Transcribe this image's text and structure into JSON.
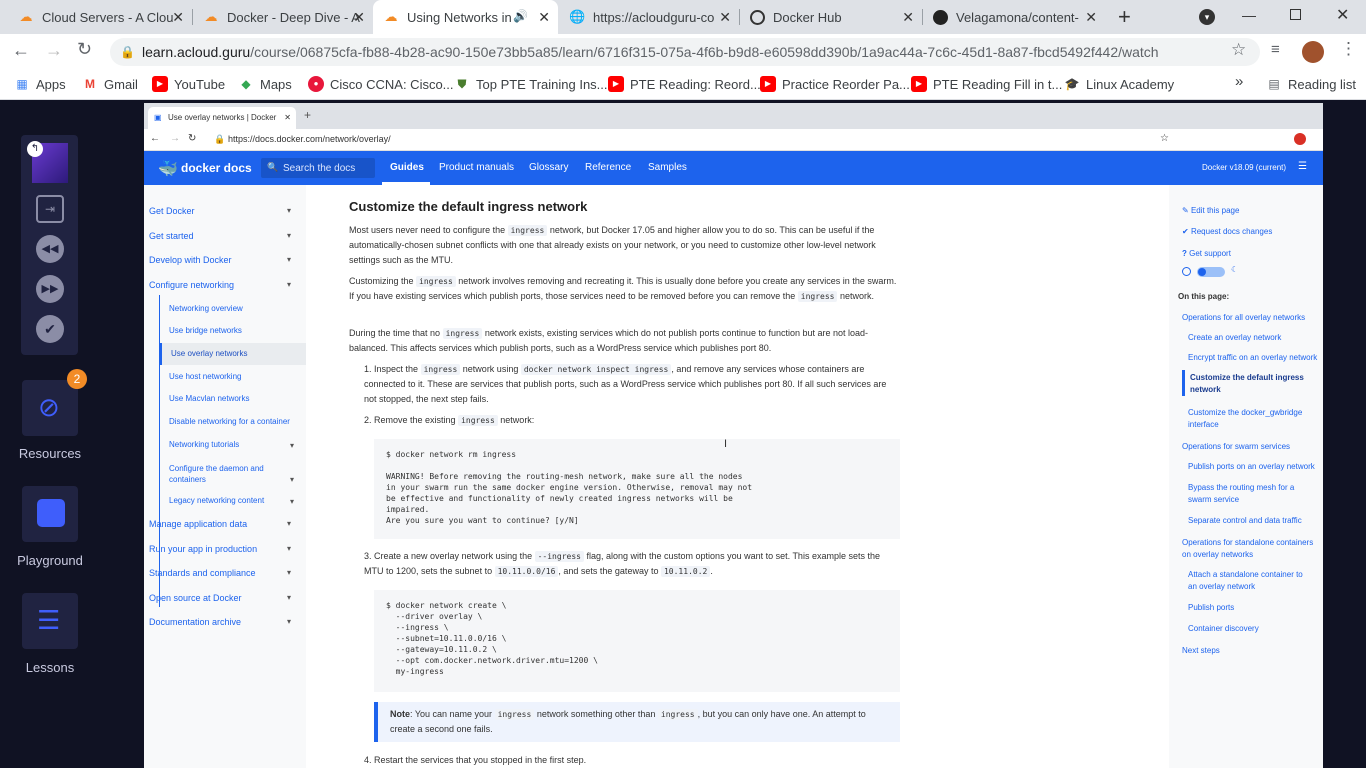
{
  "browser": {
    "tabs": [
      {
        "title": "Cloud Servers - A Clou",
        "favicon": "acg-cloud-icon"
      },
      {
        "title": "Docker - Deep Dive - A",
        "favicon": "acg-cloud-icon"
      },
      {
        "title": "Using Networks in",
        "favicon": "acg-cloud-icon"
      },
      {
        "title": "https://acloudguru-co",
        "favicon": "globe-icon"
      },
      {
        "title": "Docker Hub",
        "favicon": "docker-hub-icon"
      },
      {
        "title": "Velagamona/content-",
        "favicon": "github-icon"
      }
    ],
    "url_host": "learn.acloud.guru",
    "url_path": "/course/06875cfa-fb88-4b28-ac90-150e73bb5a85/learn/6716f315-075a-4f6b-b9d8-e60598dd390b/1a9ac44a-7c6c-45d1-8a87-fbcd5492f442/watch",
    "bookmarks": [
      "Apps",
      "Gmail",
      "YouTube",
      "Maps",
      "Cisco CCNA: Cisco...",
      "Top PTE Training Ins...",
      "PTE Reading: Reord...",
      "Practice Reorder Pa...",
      "PTE Reading Fill in t...",
      "Linux Academy"
    ],
    "reading_list": "Reading list",
    "overflow": "»"
  },
  "rail": {
    "resources_label": "Resources",
    "resources_badge": "2",
    "playground_label": "Playground",
    "lessons_label": "Lessons"
  },
  "inner": {
    "tab_title": "Use overlay networks | Docker",
    "url": "https://docs.docker.com/network/overlay/",
    "brand": "docker docs",
    "search_placeholder": "Search the docs",
    "nav": [
      "Guides",
      "Product manuals",
      "Glossary",
      "Reference",
      "Samples"
    ],
    "version": "Docker v18.09 (current)"
  },
  "left_nav": {
    "sections": [
      "Get Docker",
      "Get started",
      "Develop with Docker",
      "Configure networking"
    ],
    "sub": [
      "Networking overview",
      "Use bridge networks",
      "Use overlay networks",
      "Use host networking",
      "Use Macvlan networks",
      "Disable networking for a container",
      "Networking tutorials",
      "Configure the daemon and containers",
      "Legacy networking content"
    ],
    "sections2": [
      "Manage application data",
      "Run your app in production",
      "Standards and compliance",
      "Open source at Docker",
      "Documentation archive"
    ]
  },
  "article": {
    "heading": "Customize the default ingress network",
    "p1a": "Most users never need to configure the",
    "p1code": "ingress",
    "p1b": "network, but Docker 17.05 and higher allow you to do so. This can be useful if the automatically-chosen subnet conflicts with one that already exists on your network, or you need to customize other low-level network settings such as the MTU.",
    "p2a": "Customizing the",
    "p2code": "ingress",
    "p2b": "network involves removing and recreating it. This is usually done before you create any services in the swarm. If you have existing services which publish ports, those services need to be removed before you can remove the",
    "p2code2": "ingress",
    "p2c": "network.",
    "p3a": "During the time that no",
    "p3code": "ingress",
    "p3b": "network exists, existing services which do not publish ports continue to function but are not load-balanced. This affects services which publish ports, such as a WordPress service which publishes port 80.",
    "s1a": "1. Inspect the",
    "s1code": "ingress",
    "s1b": "network using",
    "s1code2": "docker network inspect ingress",
    "s1c": ", and remove any services whose containers are connected to it. These are services that publish ports, such as a WordPress service which publishes port 80. If all such services are not stopped, the next step fails.",
    "s2a": "2. Remove the existing",
    "s2code": "ingress",
    "s2b": "network:",
    "code1": "$ docker network rm ingress\n\nWARNING! Before removing the routing-mesh network, make sure all the nodes\nin your swarm run the same docker engine version. Otherwise, removal may not\nbe effective and functionality of newly created ingress networks will be\nimpaired.\nAre you sure you want to continue? [y/N]",
    "s3a": "3. Create a new overlay network using the",
    "s3code": "--ingress",
    "s3b": "flag, along with the custom options you want to set. This example sets the MTU to 1200, sets the subnet to",
    "s3code2": "10.11.0.0/16",
    "s3c": ", and sets the gateway to",
    "s3code3": "10.11.0.2",
    "s3d": ".",
    "code2": "$ docker network create \\\n  --driver overlay \\\n  --ingress \\\n  --subnet=10.11.0.0/16 \\\n  --gateway=10.11.0.2 \\\n  --opt com.docker.network.driver.mtu=1200 \\\n  my-ingress",
    "note_label": "Note",
    "note_a": ": You can name your",
    "note_code": "ingress",
    "note_b": "network something other than",
    "note_code2": "ingress",
    "note_c": ", but you can only have one. An attempt to create a second one fails.",
    "s4": "4. Restart the services that you stopped in the first step."
  },
  "right_nav": {
    "edit": "Edit this page",
    "request": "Request docs changes",
    "support": "Get support",
    "on_this_page": "On this page:",
    "items": [
      "Operations for all overlay networks",
      "Create an overlay network",
      "Encrypt traffic on an overlay network",
      "Customize the default ingress network",
      "Customize the docker_gwbridge interface",
      "Operations for swarm services",
      "Publish ports on an overlay network",
      "Bypass the routing mesh for a swarm service",
      "Separate control and data traffic",
      "Operations for standalone containers on overlay networks",
      "Attach a standalone container to an overlay network",
      "Publish ports",
      "Container discovery",
      "Next steps"
    ]
  },
  "colors": {
    "docker_blue": "#1d63ed",
    "acg_dark": "#101223",
    "rail_button": "#202341"
  }
}
